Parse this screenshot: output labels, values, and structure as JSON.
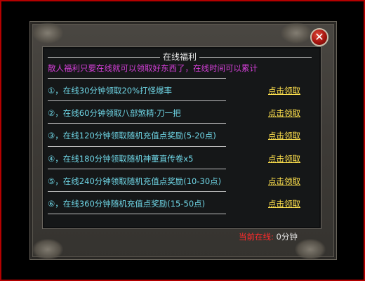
{
  "dialog": {
    "title": "在线福利",
    "subtitle": "散人福利只要在线就可以领取好东西了，在线时间可以累计",
    "close_label": "✕"
  },
  "items": [
    {
      "text": "①，在线30分钟领取20%打怪爆率",
      "claim": "点击领取"
    },
    {
      "text": "②，在线60分钟领取八部煞精·刀一把",
      "claim": "点击领取"
    },
    {
      "text": "③，在线120分钟领取随机充值点奖励(5-20点)",
      "claim": "点击领取"
    },
    {
      "text": "④，在线180分钟领取随机神董直传卷x5",
      "claim": "点击领取"
    },
    {
      "text": "⑤，在线240分钟领取随机充值点奖励(10-30点)",
      "claim": "点击领取"
    },
    {
      "text": "⑥，在线360分钟随机充值点奖励(15-50点)",
      "claim": "点击领取"
    }
  ],
  "status": {
    "label": "当前在线:",
    "value": "0分钟"
  }
}
